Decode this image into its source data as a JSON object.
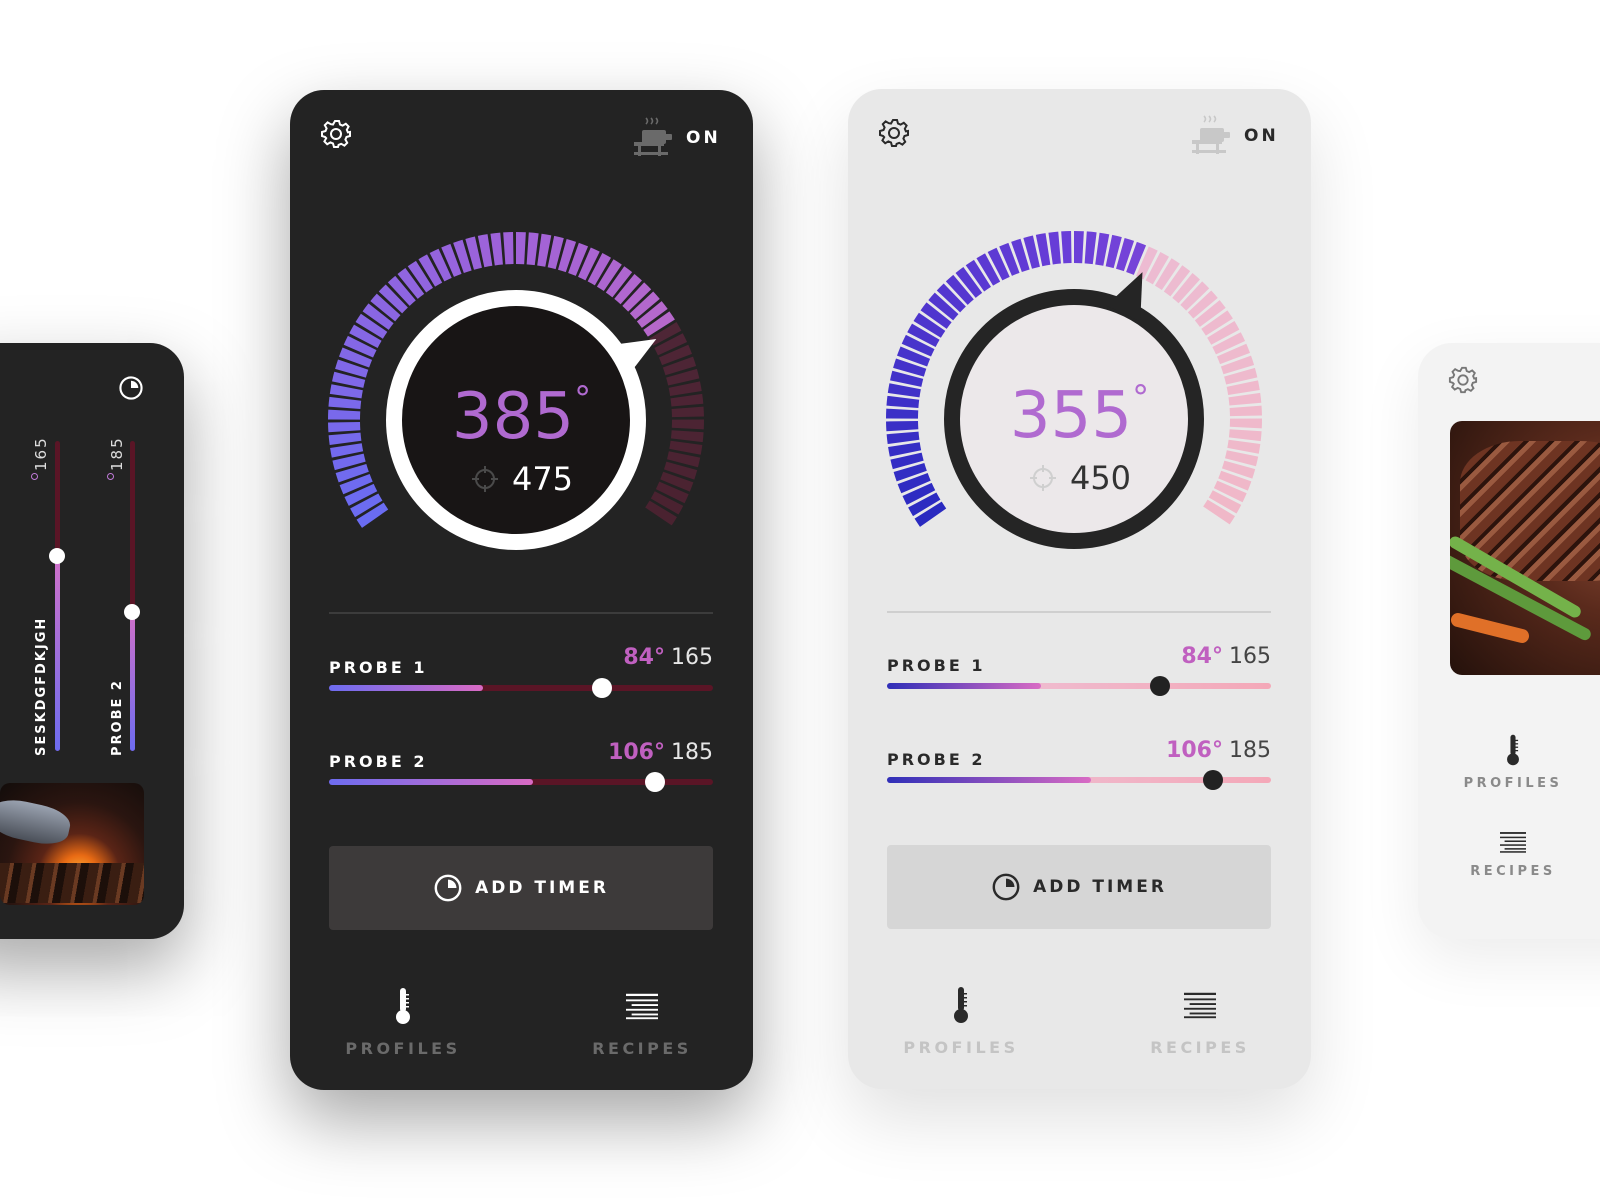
{
  "colors": {
    "accent_purple": "#b06ad0",
    "probe_current": "#c060c0",
    "dark_bg": "#232323",
    "light_bg": "#e8e8e8"
  },
  "left_card": {
    "timer_icon": "timer-icon",
    "probe1": {
      "label": "SESKDGFDKJGH",
      "target": "165",
      "level": 0.63
    },
    "probe2": {
      "label": "PROBE 2",
      "target": "185",
      "level": 0.45
    }
  },
  "dark_screen": {
    "settings_icon": "gear-icon",
    "grill_icon": "grill-icon",
    "grill_status": "ON",
    "current_temp": "385",
    "degree": "°",
    "target_temp": "475",
    "dial_level": 0.74,
    "probes": [
      {
        "label": "PROBE 1",
        "current": "84°",
        "target": "165",
        "fill": 0.4,
        "knob": 0.71
      },
      {
        "label": "PROBE 2",
        "current": "106°",
        "target": "185",
        "fill": 0.53,
        "knob": 0.85
      }
    ],
    "add_timer": "ADD TIMER",
    "nav": [
      {
        "label": "PROFILES",
        "icon": "thermometer-icon"
      },
      {
        "label": "RECIPES",
        "icon": "list-icon"
      }
    ]
  },
  "light_screen": {
    "settings_icon": "gear-icon",
    "grill_icon": "grill-icon",
    "grill_status": "ON",
    "current_temp": "355",
    "degree": "°",
    "target_temp": "450",
    "dial_level": 0.6,
    "probes": [
      {
        "label": "PROBE 1",
        "current": "84°",
        "target": "165",
        "fill": 0.4,
        "knob": 0.71
      },
      {
        "label": "PROBE 2",
        "current": "106°",
        "target": "185",
        "fill": 0.53,
        "knob": 0.85
      }
    ],
    "add_timer": "ADD TIMER",
    "nav": [
      {
        "label": "PROFILES",
        "icon": "thermometer-icon"
      },
      {
        "label": "RECIPES",
        "icon": "list-icon"
      }
    ]
  },
  "right_card": {
    "settings_icon": "gear-icon",
    "nav": [
      {
        "label": "PROFILES",
        "icon": "thermometer-icon"
      },
      {
        "label": "RECIPES",
        "icon": "list-icon"
      }
    ]
  }
}
